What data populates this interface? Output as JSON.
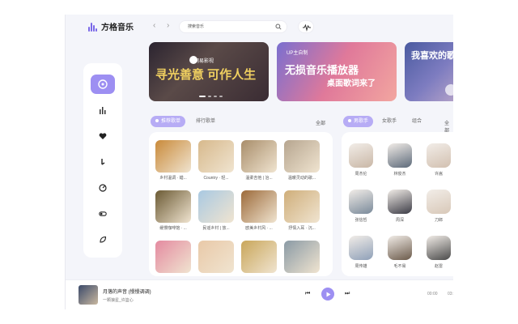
{
  "app": {
    "title": "方格音乐"
  },
  "search": {
    "value": "搜索音乐"
  },
  "banners": [
    {
      "brand": "网易影视",
      "headline": "寻光善意 可作人生"
    },
    {
      "tag": "UP主自制",
      "headline": "无损音乐播放器",
      "sub": "桌面歌词来了"
    },
    {
      "headline": "我喜欢的歌"
    }
  ],
  "playlists": {
    "tabs": [
      "推荐歌单",
      "排行歌单"
    ],
    "more": "全部",
    "items": [
      {
        "caption": "乡村温调 · 蜡...",
        "color": "#c98a3a"
      },
      {
        "caption": "Country · 轻...",
        "color": "#d7b98c"
      },
      {
        "caption": "温柔吉他 | 治...",
        "color": "#a88d6a"
      },
      {
        "caption": "温暖灵动的歌...",
        "color": "#b6a58f"
      },
      {
        "caption": "缓慢咖啡馆 · ...",
        "color": "#6b5a34"
      },
      {
        "caption": "民谣乡村 | 放...",
        "color": "#a9c9e2"
      },
      {
        "caption": "欧美乡村风 · ...",
        "color": "#9c6a3a"
      },
      {
        "caption": "抒情入耳 · 沉...",
        "color": "#cfae7a"
      },
      {
        "caption": "",
        "color": "#e48aa0"
      },
      {
        "caption": "",
        "color": "#e9c9a8"
      },
      {
        "caption": "",
        "color": "#c9a65a"
      },
      {
        "caption": "",
        "color": "#8a9aa5"
      }
    ]
  },
  "singers": {
    "tabs": [
      "男歌手",
      "女歌手",
      "组合"
    ],
    "more": "全部",
    "items": [
      {
        "name": "周杰伦"
      },
      {
        "name": "林俊杰"
      },
      {
        "name": "许嵩"
      },
      {
        "name": "张信哲"
      },
      {
        "name": "周深"
      },
      {
        "name": "刀郎"
      },
      {
        "name": "周传雄"
      },
      {
        "name": "毛不易"
      },
      {
        "name": "赵雷"
      }
    ]
  },
  "player": {
    "title": "月落的声音 (慢慢调调)",
    "artist": "一颗狼星_许篮心",
    "time_current": "00:00",
    "time_total": "03:"
  }
}
